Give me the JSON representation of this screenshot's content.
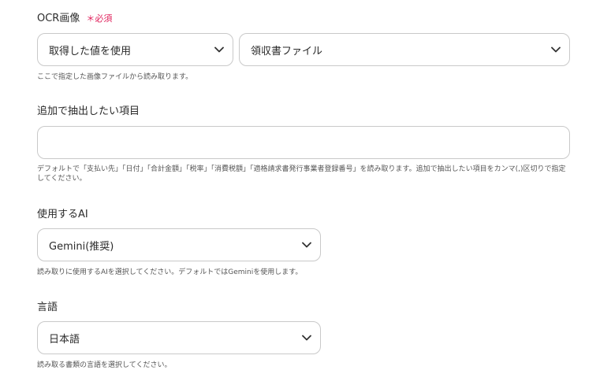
{
  "ocr_image": {
    "label": "OCR画像",
    "required": "＊必須",
    "source_select": "取得した値を使用",
    "file_select": "領収書ファイル",
    "help": "ここで指定した画像ファイルから読み取ります。"
  },
  "extra_fields": {
    "label": "追加で抽出したい項目",
    "value": "",
    "placeholder": "",
    "help": "デフォルトで「支払い先」「日付」「合計金額」「税率」「消費税額」「適格請求書発行事業者登録番号」を読み取ります。追加で抽出したい項目をカンマ(,)区切りで指定してください。"
  },
  "ai_model": {
    "label": "使用するAI",
    "selected": "Gemini(推奨)",
    "help": "読み取りに使用するAIを選択してください。デフォルトではGeminiを使用します。"
  },
  "language": {
    "label": "言語",
    "selected": "日本語",
    "help": "読み取る書類の言語を選択してください。"
  },
  "colors": {
    "required": "#e0245e",
    "border": "#c9c9c9",
    "text": "#2b2b2b"
  },
  "icons": {
    "dropdown": "chevron-down-icon"
  }
}
